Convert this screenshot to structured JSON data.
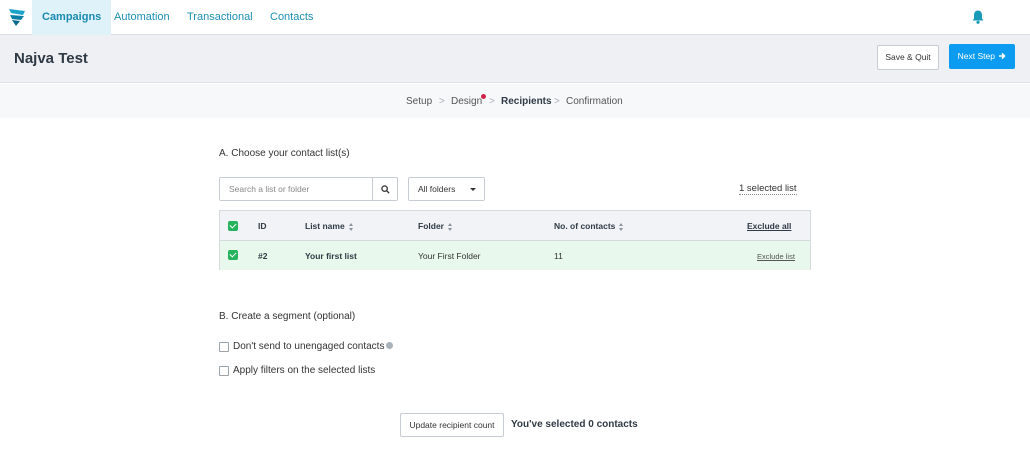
{
  "nav": {
    "tabs": [
      {
        "label": "Campaigns",
        "active": true
      },
      {
        "label": "Automation",
        "active": false
      },
      {
        "label": "Transactional",
        "active": false
      },
      {
        "label": "Contacts",
        "active": false
      }
    ],
    "logo_icon": "brand-logo-icon",
    "bell_icon": "bell-icon",
    "accent_color": "#1d8fb3",
    "bell_color": "#1a9ab9"
  },
  "header": {
    "title": "Najva Test",
    "save_label": "Save & Quit",
    "next_label": "Next Step",
    "next_icon": "arrow-right-icon",
    "next_color": "#0b9bf0"
  },
  "stepper": {
    "steps": [
      {
        "label": "Setup",
        "current": false
      },
      {
        "label": "Design",
        "current": false,
        "alert_dot": true
      },
      {
        "label": "Recipients",
        "current": true
      },
      {
        "label": "Confirmation",
        "current": false
      }
    ],
    "separator": ">",
    "alert_color": "#d0244a"
  },
  "section_a": {
    "title": "A. Choose your contact list(s)",
    "search_placeholder": "Search a list or folder",
    "search_value": "",
    "search_icon": "search-icon",
    "folder_filter": "All folders",
    "selected_count": "1 selected list"
  },
  "table": {
    "headers": {
      "id": "ID",
      "list_name": "List name",
      "folder": "Folder",
      "contacts": "No. of contacts",
      "exclude_all": "Exclude all"
    },
    "header_checked": true,
    "rows": [
      {
        "checked": true,
        "id": "#2",
        "list_name": "Your first list",
        "folder": "Your First Folder",
        "contacts": "11",
        "action": "Exclude list"
      }
    ],
    "check_color": "#25b35e",
    "row_highlight": "#e8f8ec"
  },
  "section_b": {
    "title": "B. Create a segment (optional)",
    "options": [
      {
        "label": "Don't send to unengaged contacts",
        "checked": false,
        "info_icon": "info-icon"
      },
      {
        "label": "Apply filters on the selected lists",
        "checked": false
      }
    ]
  },
  "footer": {
    "update_label": "Update recipient count",
    "recipient_text": "You've selected 0 contacts"
  }
}
